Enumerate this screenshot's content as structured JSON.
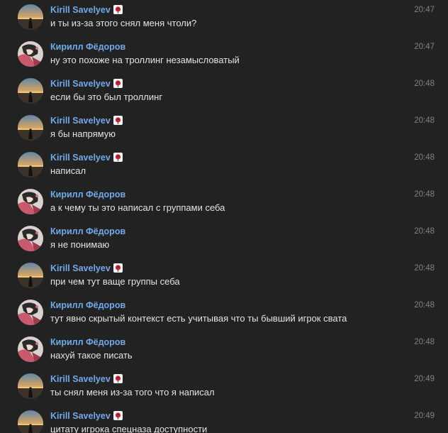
{
  "colors": {
    "background": "#222222",
    "author": "#71aaeb",
    "text": "#e1e3e6",
    "time": "#828282"
  },
  "messages": [
    {
      "author": "Kirill Savelyev",
      "avatar": "sunset-landscape-avatar",
      "badge": "rose-emoji-icon",
      "time": "20:47",
      "text": "и ты из-за этого снял меня чтоли?"
    },
    {
      "author": "Кирилл Фёдоров",
      "avatar": "anime-character-avatar",
      "badge": "",
      "time": "20:47",
      "text": "ну это похоже на троллинг незамысловатый"
    },
    {
      "author": "Kirill Savelyev",
      "avatar": "sunset-landscape-avatar",
      "badge": "rose-emoji-icon",
      "time": "20:48",
      "text": "если бы это был троллинг"
    },
    {
      "author": "Kirill Savelyev",
      "avatar": "sunset-landscape-avatar",
      "badge": "rose-emoji-icon",
      "time": "20:48",
      "text": "я бы напрямую"
    },
    {
      "author": "Kirill Savelyev",
      "avatar": "sunset-landscape-avatar",
      "badge": "rose-emoji-icon",
      "time": "20:48",
      "text": "написал"
    },
    {
      "author": "Кирилл Фёдоров",
      "avatar": "anime-character-avatar",
      "badge": "",
      "time": "20:48",
      "text": "а к чему ты это написал с группами себа"
    },
    {
      "author": "Кирилл Фёдоров",
      "avatar": "anime-character-avatar",
      "badge": "",
      "time": "20:48",
      "text": "я не понимаю"
    },
    {
      "author": "Kirill Savelyev",
      "avatar": "sunset-landscape-avatar",
      "badge": "rose-emoji-icon",
      "time": "20:48",
      "text": "при чем тут ваще группы себа"
    },
    {
      "author": "Кирилл Фёдоров",
      "avatar": "anime-character-avatar",
      "badge": "",
      "time": "20:48",
      "text": "тут явно скрытый контекст есть учитывая что ты бывший игрок свата"
    },
    {
      "author": "Кирилл Фёдоров",
      "avatar": "anime-character-avatar",
      "badge": "",
      "time": "20:48",
      "text": "нахуй такое писать"
    },
    {
      "author": "Kirill Savelyev",
      "avatar": "sunset-landscape-avatar",
      "badge": "rose-emoji-icon",
      "time": "20:49",
      "text": "ты снял меня из-за того что я написал"
    },
    {
      "author": "Kirill Savelyev",
      "avatar": "sunset-landscape-avatar",
      "badge": "rose-emoji-icon",
      "time": "20:49",
      "text": "цитату игрока спецназа доступности"
    }
  ]
}
